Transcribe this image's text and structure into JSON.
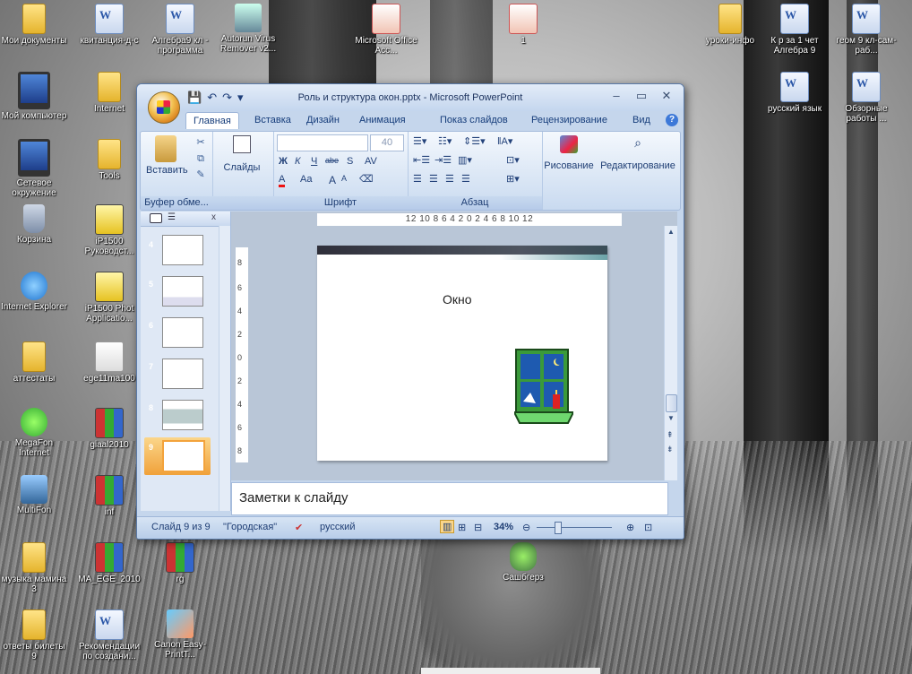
{
  "desktop": {
    "icons": [
      {
        "label": "Мои документы",
        "icon": "my-documents-icon"
      },
      {
        "label": "квитанция-д-с",
        "icon": "word-document-icon"
      },
      {
        "label": "Алгебра9 кл - программа",
        "icon": "word-document-icon"
      },
      {
        "label": "Autorun Virus Remover v2...",
        "icon": "setup-icon"
      },
      {
        "label": "Microsoft Office Acc...",
        "icon": "office-icon"
      },
      {
        "label": "1",
        "icon": "powerpoint-document-icon"
      },
      {
        "label": "уроки-инфо",
        "icon": "folder-icon"
      },
      {
        "label": "К р за 1 чет Алгебра 9",
        "icon": "word-document-icon"
      },
      {
        "label": "геом 9 кл-сам-раб...",
        "icon": "word-document-icon"
      },
      {
        "label": "Мой компьютер",
        "icon": "my-computer-icon"
      },
      {
        "label": "Internet",
        "icon": "folder-icon"
      },
      {
        "label": "русский язык",
        "icon": "word-document-icon"
      },
      {
        "label": "Обзорные работы ...",
        "icon": "word-document-icon"
      },
      {
        "label": "Сетевое окружение",
        "icon": "network-icon"
      },
      {
        "label": "Tools",
        "icon": "folder-icon"
      },
      {
        "label": "Корзина",
        "icon": "recycle-bin-icon"
      },
      {
        "label": "iP1500 Руководст...",
        "icon": "help-icon"
      },
      {
        "label": "Internet Explorer",
        "icon": "internet-explorer-icon"
      },
      {
        "label": "iP1500 Phot Applicatio...",
        "icon": "help-icon"
      },
      {
        "label": "аттестаты",
        "icon": "folder-icon"
      },
      {
        "label": "ege11ma100",
        "icon": "pdf-icon"
      },
      {
        "label": "MegaFon Internet",
        "icon": "megafon-icon"
      },
      {
        "label": "giaal2010",
        "icon": "archive-icon"
      },
      {
        "label": "MultiFon",
        "icon": "phone-icon"
      },
      {
        "label": "inf",
        "icon": "archive-icon"
      },
      {
        "label": "музыка мамина 3",
        "icon": "folder-icon"
      },
      {
        "label": "MA_EGE_2010",
        "icon": "archive-icon"
      },
      {
        "label": "rg",
        "icon": "archive-icon"
      },
      {
        "label": "Сашбгерз",
        "icon": "frog-icon"
      },
      {
        "label": "ответы билеты 9",
        "icon": "folder-icon"
      },
      {
        "label": "Рекомендации по создани...",
        "icon": "word-document-icon"
      },
      {
        "label": "Canon Easy-PrintT...",
        "icon": "canon-icon"
      }
    ]
  },
  "window": {
    "title": "Роль и структура окон.pptx - Microsoft PowerPoint",
    "controls": {
      "minimize": "–",
      "maximize": "▭",
      "close": "✕"
    },
    "tabs": [
      "Главная",
      "Вставка",
      "Дизайн",
      "Анимация",
      "Показ слайдов",
      "Рецензирование",
      "Вид"
    ],
    "active_tab": "Главная",
    "ribbon": {
      "clipboard": {
        "paste": "Вставить",
        "label": "Буфер обме..."
      },
      "slides": {
        "label": "Слайды"
      },
      "font": {
        "label": "Шрифт",
        "font_name": "",
        "font_size": "40",
        "bold": "Ж",
        "italic": "К",
        "underline": "Ч",
        "strike": "abe",
        "shadow": "S",
        "spacing": "AV",
        "color": "A",
        "case": "Aa",
        "grow": "A",
        "shrink": "A"
      },
      "paragraph": {
        "label": "Абзац"
      },
      "drawing": {
        "label": "Рисование"
      },
      "editing": {
        "label": "Редактирование"
      }
    },
    "ruler": "12  10  8  6  4  2  0  2  4  6  8  10  12",
    "vruler": [
      "8",
      "6",
      "4",
      "2",
      "0",
      "2",
      "4",
      "6",
      "8"
    ],
    "slides_panel": [
      {
        "number": "4"
      },
      {
        "number": "5"
      },
      {
        "number": "6"
      },
      {
        "number": "7"
      },
      {
        "number": "8"
      },
      {
        "number": "9",
        "selected": true
      }
    ],
    "slide": {
      "title": "Окно"
    },
    "notes_placeholder": "Заметки к слайду",
    "status": {
      "slide": "Слайд 9 из 9",
      "theme": "\"Городская\"",
      "language": "русский",
      "zoom": "34%"
    }
  }
}
